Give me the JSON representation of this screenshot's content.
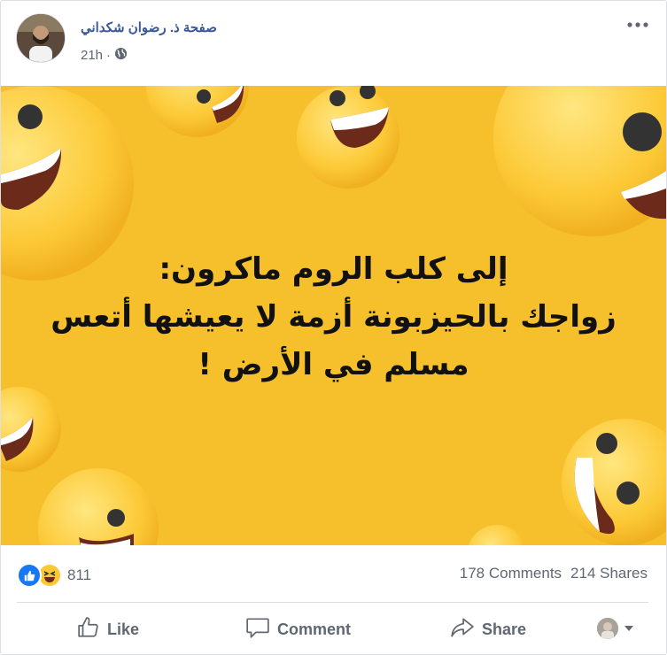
{
  "post": {
    "page_name": "صفحة ذ. رضوان شكداني",
    "time": "21h",
    "separator": "·",
    "privacy_icon": "globe-icon",
    "more_icon": "more-dots-icon",
    "image_text": {
      "line1": "إلى كلب الروم ماكرون:",
      "line2": "زواجك بالحيزبونة أزمة لا يعيشها أتعس",
      "line3": "مسلم في الأرض !"
    },
    "image_background": "#f6c02c"
  },
  "stats": {
    "reaction_icons": [
      "like-reaction-icon",
      "haha-reaction-icon"
    ],
    "reaction_count": "811",
    "comments": "178 Comments",
    "shares": "214 Shares"
  },
  "actions": {
    "like_label": "Like",
    "comment_label": "Comment",
    "share_label": "Share",
    "audience_icon": "chevron-down-icon"
  },
  "colors": {
    "link_blue": "#385898",
    "like_blue": "#1877f2",
    "text_gray": "#606770",
    "emoji_yellow": "#fcc936"
  }
}
